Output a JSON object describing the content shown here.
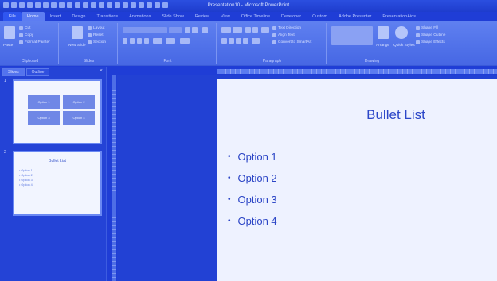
{
  "window": {
    "title": "Presentation10 - Microsoft PowerPoint"
  },
  "ribbon_tabs": [
    "File",
    "Home",
    "Insert",
    "Design",
    "Transitions",
    "Animations",
    "Slide Show",
    "Review",
    "View",
    "Office Timeline",
    "Developer",
    "Custom",
    "Adobe Presenter",
    "PresentationAids"
  ],
  "ribbon": {
    "clipboard": {
      "paste": "Paste",
      "cut": "Cut",
      "copy": "Copy",
      "format_painter": "Format Painter",
      "label": "Clipboard"
    },
    "slides": {
      "new_slide": "New Slide",
      "layout": "Layout",
      "reset": "Reset",
      "section": "Section",
      "label": "Slides"
    },
    "font": {
      "label": "Font"
    },
    "paragraph": {
      "text_direction": "Text Direction",
      "align_text": "Align Text",
      "convert_smartart": "Convert to SmartArt",
      "label": "Paragraph"
    },
    "drawing": {
      "arrange": "Arrange",
      "quick_styles": "Quick Styles",
      "shape_fill": "Shape Fill",
      "shape_outline": "Shape Outline",
      "shape_effects": "Shape Effects",
      "label": "Drawing"
    }
  },
  "panel": {
    "tabs": [
      "Slides",
      "Outline"
    ],
    "close_glyph": "×",
    "slides": [
      {
        "number": "1",
        "boxes": [
          "Option 1",
          "Option 2",
          "Option 3",
          "Option 4"
        ]
      },
      {
        "number": "2",
        "title": "Bullet List",
        "bullets": [
          "• Option 1",
          "• Option 2",
          "• Option 3",
          "• Option 4"
        ]
      }
    ]
  },
  "slide": {
    "title": "Bullet List",
    "bullets": [
      "Option 1",
      "Option 2",
      "Option 3",
      "Option 4"
    ]
  },
  "colors": {
    "tint": "#1f3dd6",
    "slide_bg": "#eef2ff",
    "text": "#2b45c6"
  }
}
